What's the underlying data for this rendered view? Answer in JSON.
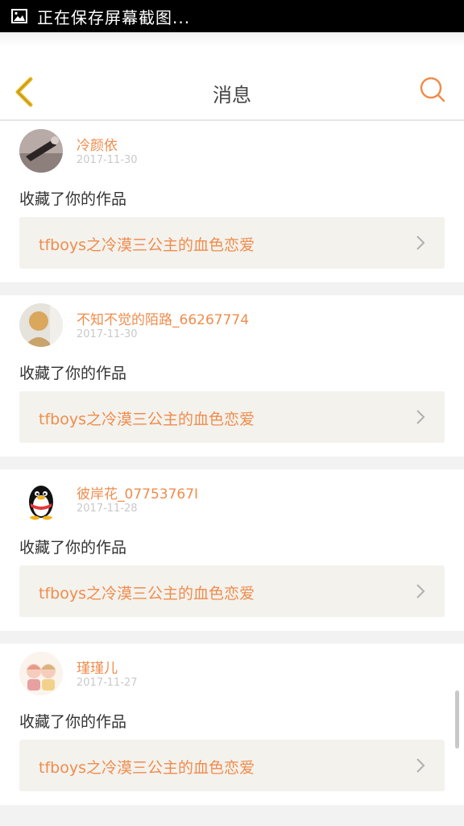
{
  "status_bar": {
    "text": "正在保存屏幕截图..."
  },
  "header": {
    "title": "消息"
  },
  "messages": [
    {
      "username": "冷颜依",
      "date": "2017-11-30",
      "action": "收藏了你的作品",
      "work_title": "tfboys之冷漠三公主的血色恋爱"
    },
    {
      "username": "不知不觉的陌路_66267774",
      "date": "2017-11-30",
      "action": "收藏了你的作品",
      "work_title": "tfboys之冷漠三公主的血色恋爱"
    },
    {
      "username": "彼岸花_07753767I",
      "date": "2017-11-28",
      "action": "收藏了你的作品",
      "work_title": "tfboys之冷漠三公主的血色恋爱"
    },
    {
      "username": "瑾瑾儿",
      "date": "2017-11-27",
      "action": "收藏了你的作品",
      "work_title": "tfboys之冷漠三公主的血色恋爱"
    }
  ],
  "colors": {
    "accent": "#f08c4d",
    "back_arrow": "#e8b923"
  }
}
